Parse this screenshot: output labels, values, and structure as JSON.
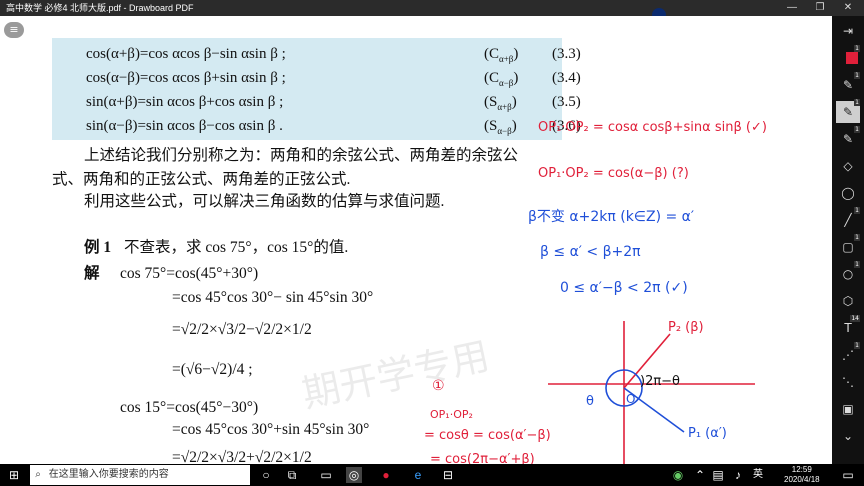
{
  "window": {
    "title": "高中数学 必修4 北师大版.pdf - Drawboard PDF",
    "minimize_glyph": "—",
    "maximize_glyph": "❐",
    "close_glyph": "✕"
  },
  "app": {
    "menu_icon": "hamburger-icon",
    "menu_glyph": "≡"
  },
  "formulas": [
    {
      "formula": "cos(α+β)=cos αcos β−sin αsin β ;",
      "label": "(C",
      "sub": "α+β",
      "num": "(3.3)"
    },
    {
      "formula": "cos(α−β)=cos αcos β+sin αsin β ;",
      "label": "(C",
      "sub": "α−β",
      "num": "(3.4)"
    },
    {
      "formula": "sin(α+β)=sin αcos β+cos αsin β ;",
      "label": "(S",
      "sub": "α+β",
      "num": "(3.5)"
    },
    {
      "formula": "sin(α−β)=sin αcos β−cos αsin β .",
      "label": "(S",
      "sub": "α−β",
      "num": "(3.6)"
    }
  ],
  "text": {
    "p1_line1": "上述结论我们分别称之为：两角和的余弦公式、两角差的余弦公",
    "p1_line2": "式、两角和的正弦公式、两角差的正弦公式.",
    "p2": "利用这些公式，可以解决三角函数的估算与求值问题.",
    "example_label": "例 1",
    "example_text": "不查表，求 cos 75°，cos 15°的值.",
    "solution_label": "解",
    "s1": "cos 75°=cos(45°+30°)",
    "s2": "=cos 45°cos 30°− sin 45°sin 30°",
    "s3": "=√2/2×√3/2−√2/2×1/2",
    "s4": "=(√6−√2)/4 ;",
    "s5": "cos 15°=cos(45°−30°)",
    "s6": "=cos 45°cos 30°+sin 45°sin 30°",
    "s7": "=√2/2×√3/2+√2/2×1/2",
    "watermark": "期开学专用"
  },
  "ink": {
    "r1": "OP₁·OP₂ = cosα cosβ+sinα sinβ  (✓)",
    "r2": "OP₁·OP₂ = cos(α−β)   (?)",
    "b1": "β不变   α+2kπ (k∈Z) = α′",
    "b2": "β ≤ α′ < β+2π",
    "b3": "0 ≤ α′−β < 2π   (✓)",
    "p2lbl": "P₂ (β)",
    "p1lbl": "P₁ (α′)",
    "angle": ")2π−θ",
    "theta": "θ",
    "origin": "O",
    "circle1": "①",
    "r3": "OP₁·OP₂",
    "r4": "= cosθ = cos(α′−β)",
    "r5": "= cos(2π−α′+β)"
  },
  "sidebar": [
    {
      "name": "expand-tool",
      "glyph": "⇥",
      "badge": ""
    },
    {
      "name": "red-swatch",
      "glyph": "",
      "badge": "1",
      "color": "#e0203a"
    },
    {
      "name": "pen-tool",
      "glyph": "✎",
      "badge": "1"
    },
    {
      "name": "pen-tool-active",
      "glyph": "✎",
      "badge": "1"
    },
    {
      "name": "highlighter-tool",
      "glyph": "✎",
      "badge": "1"
    },
    {
      "name": "eraser-tool",
      "glyph": "◇",
      "badge": ""
    },
    {
      "name": "lasso-tool",
      "glyph": "◯",
      "badge": ""
    },
    {
      "name": "line-tool",
      "glyph": "╱",
      "badge": "1"
    },
    {
      "name": "rectangle-tool",
      "glyph": "▢",
      "badge": "1"
    },
    {
      "name": "ellipse-tool",
      "glyph": "○",
      "badge": "1"
    },
    {
      "name": "polygon-tool",
      "glyph": "⬡",
      "badge": ""
    },
    {
      "name": "text-tool",
      "glyph": "T",
      "badge": "14"
    },
    {
      "name": "connector-tool",
      "glyph": "⋰",
      "badge": "1"
    },
    {
      "name": "measure-tool",
      "glyph": "⋱",
      "badge": ""
    },
    {
      "name": "image-tool",
      "glyph": "▣",
      "badge": ""
    },
    {
      "name": "scroll-down",
      "glyph": "⌄",
      "badge": ""
    }
  ],
  "taskbar": {
    "search_placeholder": "在这里输入你要搜索的内容",
    "lang": "英",
    "time": "12:59",
    "date": "2020/4/18"
  },
  "colors": {
    "ink_red": "#e0203a",
    "ink_blue": "#1f4fd8",
    "formula_bg": "#d4eaf2"
  }
}
